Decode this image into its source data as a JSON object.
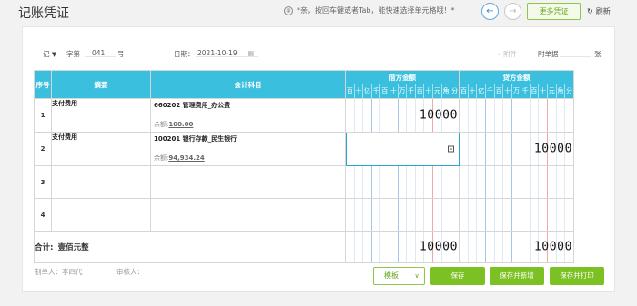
{
  "header": {
    "title": "记账凭证",
    "hint_icon": "@",
    "hint": "*亲，按回车键或者Tab，能快速选择单元格哦！*",
    "prev_icon": "arrow-left-icon",
    "next_icon": "arrow-right-icon",
    "more_label": "更多凭证",
    "refresh_label": "刷新"
  },
  "meta": {
    "word_value": "记",
    "word_label": "字第",
    "number_value": "041",
    "number_suffix": "号",
    "date_label": "日期：",
    "date_value": "2021-10-19",
    "attach_label": "附件",
    "attach_count_label": "附单据",
    "attach_unit": "张"
  },
  "table": {
    "headers": {
      "index": "序号",
      "summary": "摘要",
      "account": "会计科目",
      "debit": "借方金额",
      "credit": "贷方金额"
    },
    "digit_units": [
      "百",
      "十",
      "亿",
      "千",
      "百",
      "十",
      "万",
      "千",
      "百",
      "十",
      "元",
      "角",
      "分"
    ],
    "rows": [
      {
        "index": "1",
        "summary": "支付费用",
        "account": "660202 管理费用_办公费",
        "balance_label": "余额:",
        "balance": "100.00",
        "debit": "10000",
        "credit": ""
      },
      {
        "index": "2",
        "summary": "支付费用",
        "account": "100201 银行存款_民生银行",
        "balance_label": "余额:",
        "balance": "94,934.24",
        "debit": "",
        "credit": "10000"
      },
      {
        "index": "3",
        "summary": "",
        "account": "",
        "balance_label": "",
        "balance": "",
        "debit": "",
        "credit": ""
      },
      {
        "index": "4",
        "summary": "",
        "account": "",
        "balance_label": "",
        "balance": "",
        "debit": "",
        "credit": ""
      }
    ],
    "total_label": "合计:",
    "total_words": "壹佰元整",
    "total_debit": "10000",
    "total_credit": "10000"
  },
  "footer": {
    "maker": "制单人：李四代",
    "reviewer": "审核人：",
    "template_label": "模板",
    "save_label": "保存",
    "save_new_label": "保存并新增",
    "save_print_label": "保存并打印"
  },
  "colors": {
    "header_bg": "#3bbfdf",
    "green": "#7cc124",
    "accent_blue": "#2f8ad4"
  }
}
